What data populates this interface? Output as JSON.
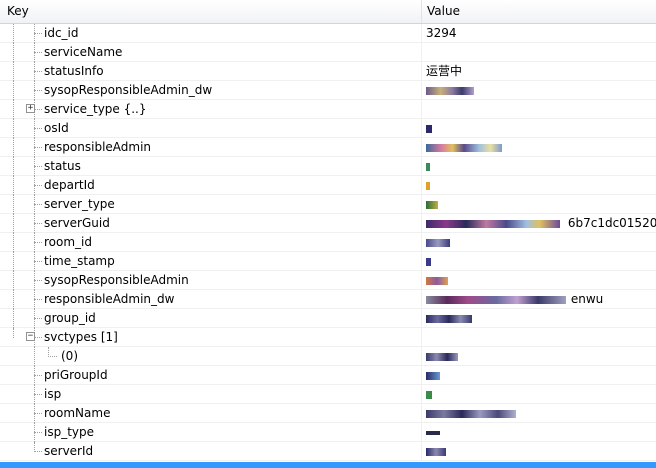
{
  "header": {
    "key": "Key",
    "value": "Value"
  },
  "rows": [
    {
      "key": "idc_id",
      "value": "3294"
    },
    {
      "key": "serviceName",
      "value": ""
    },
    {
      "key": "statusInfo",
      "value": "运营中"
    },
    {
      "key": "sysopResponsibleAdmin_dw",
      "value": ""
    },
    {
      "key": "service_type {..}",
      "value": ""
    },
    {
      "key": "osId",
      "value": ""
    },
    {
      "key": "responsibleAdmin",
      "value": ""
    },
    {
      "key": "status",
      "value": ""
    },
    {
      "key": "departId",
      "value": ""
    },
    {
      "key": "server_type",
      "value": ""
    },
    {
      "key": "serverGuid",
      "value": "6b7c1dc01520"
    },
    {
      "key": "room_id",
      "value": ""
    },
    {
      "key": "time_stamp",
      "value": ""
    },
    {
      "key": "sysopResponsibleAdmin",
      "value": ""
    },
    {
      "key": "responsibleAdmin_dw",
      "value": "enwu"
    },
    {
      "key": "group_id",
      "value": ""
    },
    {
      "key": "svctypes [1]",
      "value": ""
    },
    {
      "key": "(0)",
      "value": ""
    },
    {
      "key": "priGroupId",
      "value": ""
    },
    {
      "key": "isp",
      "value": ""
    },
    {
      "key": "roomName",
      "value": ""
    },
    {
      "key": "isp_type",
      "value": ""
    },
    {
      "key": "serverId",
      "value": ""
    }
  ],
  "colors": {
    "selection": "#3399ff",
    "tree_line": "#a0a0a0"
  }
}
